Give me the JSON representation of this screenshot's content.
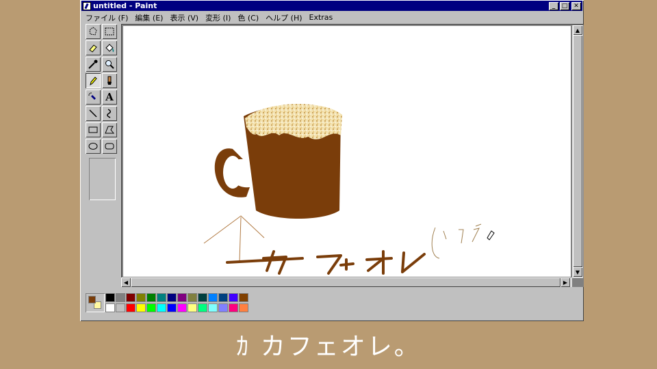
{
  "window": {
    "title": "untitled - Paint",
    "controls": {
      "minimize": "_",
      "maximize": "□",
      "close": "✕"
    }
  },
  "menu": [
    {
      "label": "ファイル (F)"
    },
    {
      "label": "編集 (E)"
    },
    {
      "label": "表示 (V)"
    },
    {
      "label": "変形 (I)"
    },
    {
      "label": "色 (C)"
    },
    {
      "label": "ヘルプ (H)"
    },
    {
      "label": "Extras"
    }
  ],
  "tools": [
    {
      "name": "free-select-icon"
    },
    {
      "name": "rect-select-icon"
    },
    {
      "name": "eraser-icon"
    },
    {
      "name": "fill-bucket-icon"
    },
    {
      "name": "color-picker-icon"
    },
    {
      "name": "magnifier-icon"
    },
    {
      "name": "pencil-icon",
      "selected": true
    },
    {
      "name": "brush-icon"
    },
    {
      "name": "airbrush-icon"
    },
    {
      "name": "text-icon",
      "glyph": "A"
    },
    {
      "name": "line-icon"
    },
    {
      "name": "curve-icon"
    },
    {
      "name": "rectangle-icon"
    },
    {
      "name": "polygon-icon"
    },
    {
      "name": "ellipse-icon"
    },
    {
      "name": "rounded-rect-icon"
    }
  ],
  "canvas": {
    "drawing": "coffee mug with foam",
    "handwritten_text": "カフェオレ"
  },
  "colors": {
    "foreground": "#7a3d0a",
    "background": "#fff8a0",
    "palette": [
      "#000000",
      "#808080",
      "#800000",
      "#808000",
      "#008000",
      "#008080",
      "#000080",
      "#800080",
      "#808040",
      "#004040",
      "#0080ff",
      "#004080",
      "#4000ff",
      "#804000",
      "#ffffff",
      "#c0c0c0",
      "#ff0000",
      "#ffff00",
      "#00ff00",
      "#00ffff",
      "#0000ff",
      "#ff00ff",
      "#ffff80",
      "#00ff80",
      "#80ffff",
      "#8080ff",
      "#ff0080",
      "#ff8040"
    ]
  },
  "subtitle": "ｶ カフェオレ。"
}
